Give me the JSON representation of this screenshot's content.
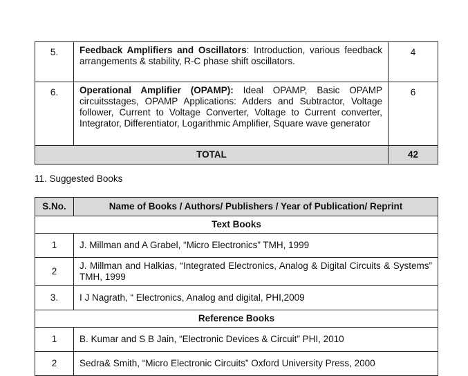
{
  "syllabus": {
    "rows": [
      {
        "sno": "5.",
        "topic": "Feedback Amplifiers and Oscillators",
        "sep": ":",
        "content": " Introduction, various feedback arrangements & stability, R-C phase shift oscillators.",
        "hours": "4"
      },
      {
        "sno": "6.",
        "topic": "Operational Amplifier (OPAMP):",
        "sep": "",
        "content": " Ideal OPAMP, Basic OPAMP circuitsstages, OPAMP Applications: Adders and Subtractor, Voltage follower, Current to Voltage Converter, Voltage to Current converter, Integrator, Differentiator, Logarithmic Amplifier, Square wave generator",
        "hours": "6"
      }
    ],
    "total_label": "TOTAL",
    "total_hours": "42"
  },
  "books_section": {
    "heading": "11.  Suggested Books",
    "col_sno": "S.No.",
    "col_name": "Name of Books / Authors/ Publishers / Year of Publication/ Reprint",
    "text_books_label": "Text Books",
    "text_books": [
      {
        "sno": "1",
        "text": "J. Millman and A Grabel, “Micro Electronics” TMH, 1999"
      },
      {
        "sno": "2",
        "text": "J. Millman and Halkias, “Integrated Electronics, Analog & Digital Circuits & Systems” TMH, 1999"
      },
      {
        "sno": "3.",
        "text": "I J Nagrath, “ Electronics, Analog and digital, PHI,2009"
      }
    ],
    "reference_books_label": "Reference Books",
    "reference_books": [
      {
        "sno": "1",
        "text": "B. Kumar and S B Jain, “Electronic Devices & Circuit” PHI, 2010"
      },
      {
        "sno": "2",
        "text": "Sedra& Smith, “Micro Electronic Circuits” Oxford University Press, 2000"
      }
    ]
  }
}
